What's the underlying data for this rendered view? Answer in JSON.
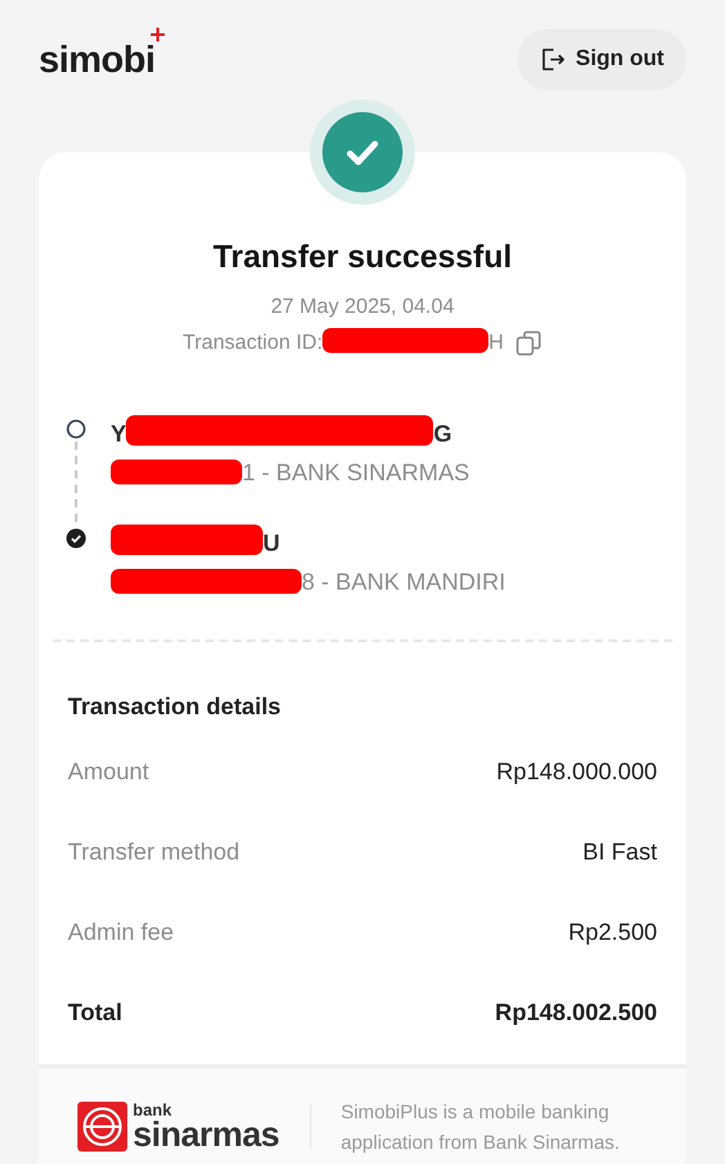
{
  "header": {
    "logo": "simobi",
    "sign_out": "Sign out"
  },
  "status": {
    "kind": "success",
    "title": "Transfer successful",
    "date": "27 May 2025, 04.04",
    "transaction_id": {
      "label": "Transaction ID:",
      "parts": [
        {
          "kind": "redacted"
        },
        {
          "kind": "text",
          "text": "H"
        }
      ]
    }
  },
  "parties": [
    {
      "kind": "origin",
      "name_parts": [
        {
          "kind": "text",
          "text": "Y"
        },
        {
          "kind": "redacted"
        },
        {
          "kind": "text",
          "text": "G"
        }
      ],
      "account_parts": [
        {
          "kind": "redacted"
        },
        {
          "kind": "text",
          "text": "1 - BANK SINARMAS"
        }
      ]
    },
    {
      "kind": "destination",
      "name_parts": [
        {
          "kind": "redacted"
        },
        {
          "kind": "text",
          "text": "U"
        }
      ],
      "account_parts": [
        {
          "kind": "redacted"
        },
        {
          "kind": "text",
          "text": "8 - BANK MANDIRI"
        }
      ]
    }
  ],
  "details": {
    "title": "Transaction details",
    "rows": [
      {
        "label": "Amount",
        "value": "Rp148.000.000",
        "kind": "normal"
      },
      {
        "label": "Transfer method",
        "value": "BI Fast",
        "kind": "normal"
      },
      {
        "label": "Admin fee",
        "value": "Rp2.500",
        "kind": "normal"
      },
      {
        "label": "Total",
        "value": "Rp148.002.500",
        "kind": "total"
      }
    ]
  },
  "footer": {
    "bank_small": "bank",
    "bank_name": "sinarmas",
    "text": "SimobiPlus is a mobile banking application from Bank Sinarmas."
  }
}
